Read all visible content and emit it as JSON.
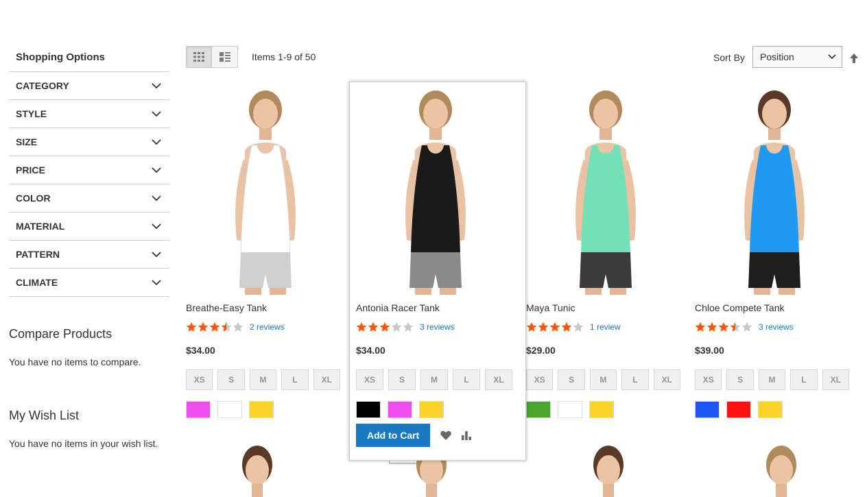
{
  "sidebar": {
    "title": "Shopping Options",
    "filters": [
      "CATEGORY",
      "STYLE",
      "SIZE",
      "PRICE",
      "COLOR",
      "MATERIAL",
      "PATTERN",
      "CLIMATE"
    ],
    "compare": {
      "title": "Compare Products",
      "text": "You have no items to compare."
    },
    "wishlist": {
      "title": "My Wish List",
      "text": "You have no items in your wish list."
    }
  },
  "toolbar": {
    "view_modes": [
      "grid-icon",
      "list-icon"
    ],
    "amount": "Items 1-9 of 50",
    "sort_label": "Sort By",
    "sort_value": "Position",
    "sort_direction_icon": "arrow-up-icon"
  },
  "products": [
    {
      "name": "Breathe-Easy Tank",
      "rating": 3.5,
      "reviews": "2 reviews",
      "price": "$34.00",
      "sizes": [
        "XS",
        "S",
        "M",
        "L",
        "XL"
      ],
      "colors": [
        "#f14cf1",
        "#ffffff",
        "#ffd22d"
      ],
      "top_color": "#ffffff",
      "shorts_color": "#cfcfcf"
    },
    {
      "name": "Antonia Racer Tank",
      "rating": 3,
      "reviews": "3 reviews",
      "price": "$34.00",
      "sizes": [
        "XS",
        "S",
        "M",
        "L",
        "XL"
      ],
      "colors": [
        "#000000",
        "#f14cf1",
        "#ffd22d"
      ],
      "top_color": "#1a1a1a",
      "shorts_color": "#8a8a8a",
      "add_to_cart": "Add to Cart",
      "tooltip": "Add to Cart"
    },
    {
      "name": "Maya Tunic",
      "rating": 4,
      "reviews": "1 review",
      "price": "$29.00",
      "sizes": [
        "XS",
        "S",
        "M",
        "L",
        "XL"
      ],
      "colors": [
        "#4aa42f",
        "#ffffff",
        "#ffd22d"
      ],
      "top_color": "#74e0b6",
      "shorts_color": "#3b3b3b"
    },
    {
      "name": "Chloe Compete Tank",
      "rating": 3.5,
      "reviews": "3 reviews",
      "price": "$39.00",
      "sizes": [
        "XS",
        "S",
        "M",
        "L",
        "XL"
      ],
      "colors": [
        "#1c57f0",
        "#ff1111",
        "#ffd22d"
      ],
      "top_color": "#1e9af0",
      "shorts_color": "#1e1e1e"
    }
  ],
  "colors": {
    "star": "#ff5501",
    "star_empty": "#c7c7c7",
    "link": "#1979c3",
    "button": "#1979c3"
  }
}
